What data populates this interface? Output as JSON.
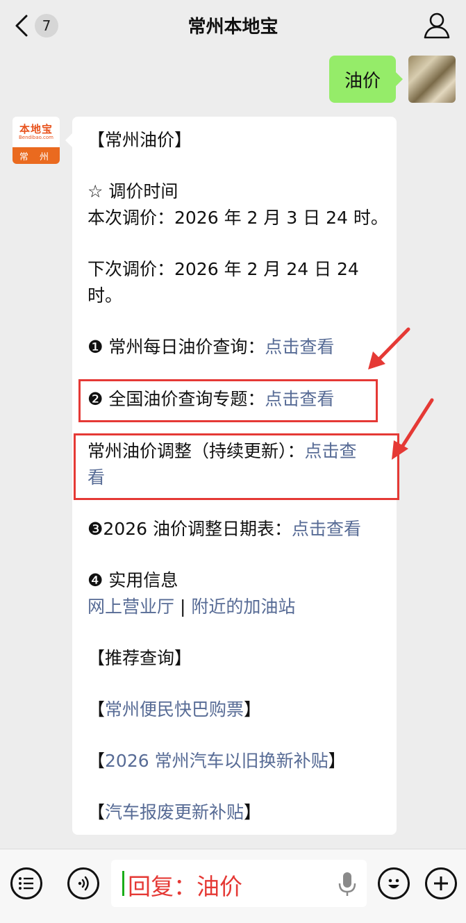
{
  "header": {
    "unread_count": "7",
    "title": "常州本地宝"
  },
  "outgoing": {
    "text": "油价"
  },
  "incoming": {
    "avatar": {
      "brand": "本地宝",
      "domain": "Bendibao.com",
      "city": "常 州"
    },
    "lines": {
      "heading": "【常州油价】",
      "section_adjust_time": "☆ 调价时间",
      "this_adjust": "本次调价：2026 年 2 月 3 日 24 时。",
      "next_adjust_1": "下次调价：2026 年 2 月 24 日 24",
      "next_adjust_2": "时。",
      "item1_label": "❶ 常州每日油价查询：",
      "item1_link": "点击查看",
      "item2_label": "❷ 全国油价查询专题：",
      "item2_link": "点击查看",
      "item_adjust_label": "常州油价调整（持续更新）：",
      "item_adjust_link_1": "点击查",
      "item_adjust_link_2": "看",
      "item3_label": "❸2026 油价调整日期表：",
      "item3_link": "点击查看",
      "item4_label": "❹ 实用信息",
      "link_online_hall": "网上营业厅",
      "separator": " | ",
      "link_gas_station": "附近的加油站",
      "recommend_heading": "【推荐查询】",
      "rec1_open": "【",
      "rec1_link": "常州便民快巴购票",
      "rec1_close": "】",
      "rec2_open": "【",
      "rec2_link": "2026 常州汽车以旧换新补贴",
      "rec2_close": "】",
      "rec3_open": "【",
      "rec3_link": "汽车报废更新补贴",
      "rec3_close": "】"
    }
  },
  "input_bar": {
    "text": "回复：油价"
  },
  "colors": {
    "link": "#576b95",
    "highlight": "#e53935",
    "outgoing_bubble": "#95ec69"
  },
  "icons": [
    "back-chevron-icon",
    "profile-icon",
    "menu-icon",
    "voice-icon",
    "microphone-icon",
    "emoji-icon",
    "plus-icon",
    "arrow-annotation-icon"
  ]
}
